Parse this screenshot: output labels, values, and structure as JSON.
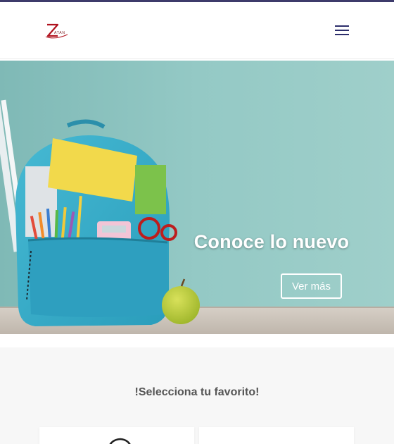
{
  "colors": {
    "accent_bar": "#3d3b6b",
    "menu_icon": "#2c2e6b",
    "logo_red": "#b0121e",
    "hero_bg": "#8fc5c0",
    "backpack": "#36acc9",
    "section_bg": "#f7f7f7"
  },
  "header": {
    "logo_name": "Z-logo",
    "logo_alt": "Zatan",
    "logo_text": "ATAN",
    "menu_icon": "hamburger-menu-icon"
  },
  "hero": {
    "title": "Conoce lo nuevo",
    "button_label": "Ver más"
  },
  "favorites": {
    "title": "!Selecciona tu favorito!",
    "cards": [
      {
        "name": "product-card-1"
      },
      {
        "name": "product-card-2"
      }
    ]
  }
}
